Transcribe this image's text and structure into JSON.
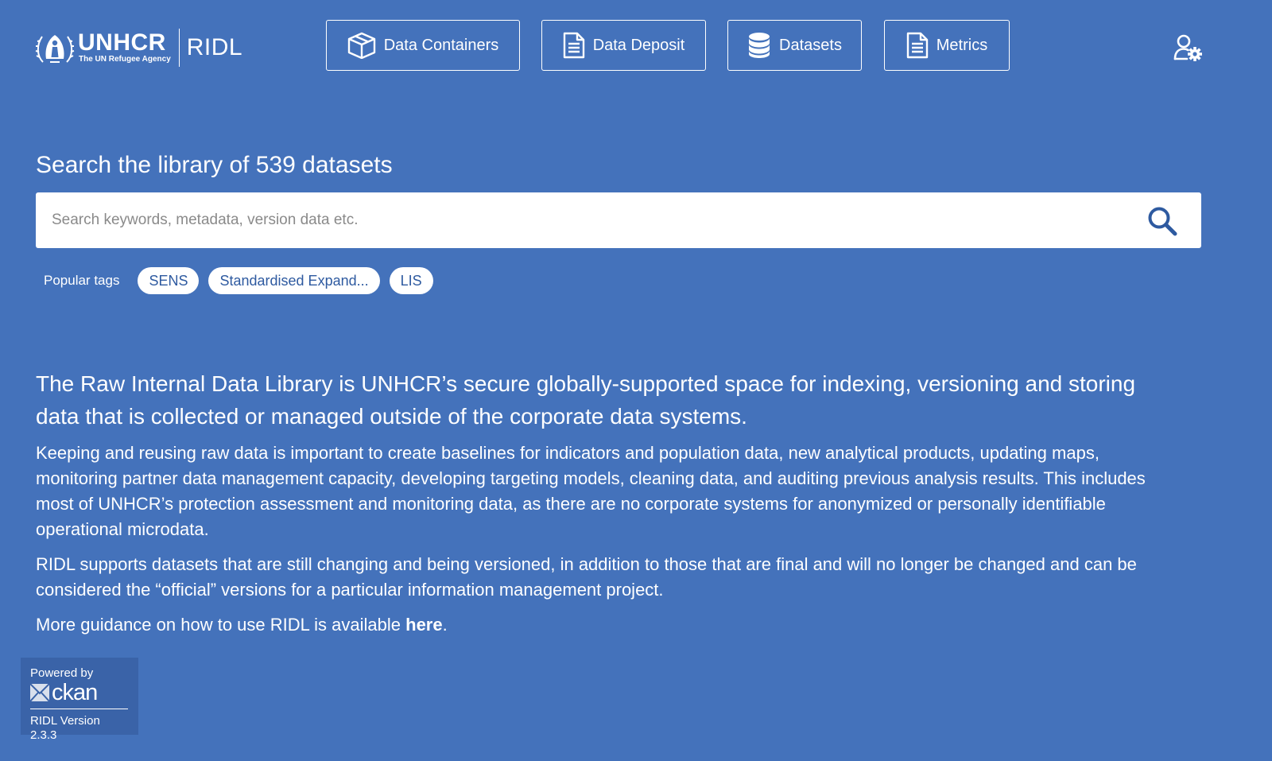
{
  "header": {
    "org_name": "UNHCR",
    "org_tagline": "The UN Refugee Agency",
    "product_name": "RIDL",
    "nav": [
      {
        "label": "Data Containers",
        "icon": "box-icon"
      },
      {
        "label": "Data Deposit",
        "icon": "document-icon"
      },
      {
        "label": "Datasets",
        "icon": "database-icon"
      },
      {
        "label": "Metrics",
        "icon": "document-icon"
      }
    ],
    "admin_icon": "user-gear-icon"
  },
  "search": {
    "title": "Search the library of 539 datasets",
    "placeholder": "Search keywords, metadata, version data etc.",
    "value": "",
    "button_icon": "search-icon"
  },
  "popular_tags": {
    "label": "Popular tags",
    "tags": [
      "SENS",
      "Standardised Expand...",
      "LIS"
    ]
  },
  "intro": {
    "lead": "The Raw Internal Data Library is UNHCR’s secure globally-supported space for indexing, versioning and storing data that is collected or managed outside of the corporate data systems.",
    "paragraph_1": "Keeping and reusing raw data is important to create baselines for indicators and population data, new analytical products, updating maps, monitoring partner data management capacity, developing targeting models, cleaning data, and auditing previous analysis results. This includes most of UNHCR’s protection assessment and monitoring data, as there are no corporate systems for anonymized or personally identifiable operational microdata.",
    "paragraph_2": "RIDL supports datasets that are still changing and being versioned, in addition to those that are final and will no longer be changed and can be considered the “official” versions for a particular information management project.",
    "guidance_prefix": "More guidance on how to use RIDL is available ",
    "guidance_link": "here",
    "guidance_suffix": "."
  },
  "footer": {
    "powered_by": "Powered by",
    "ckan_text": "ckan",
    "version": "RIDL Version 2.3.3"
  },
  "colors": {
    "background": "#4472bb",
    "tag_text": "#2e5aa0",
    "search_icon": "#2e5aa0",
    "footer_box": "#3a63a8"
  }
}
